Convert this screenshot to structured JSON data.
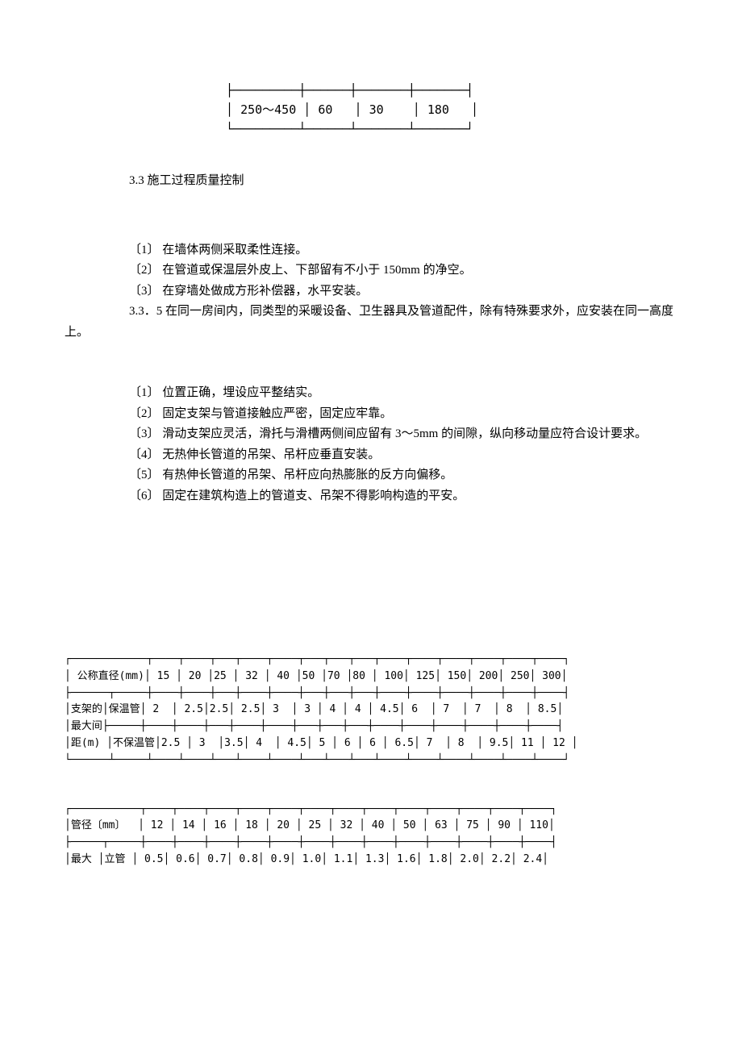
{
  "table1": {
    "row": [
      "250～450",
      "60",
      "30",
      "180"
    ]
  },
  "heading": "3.3 施工过程质量控制",
  "list1": {
    "item1": "〔1〕 在墙体两侧采取柔性连接。",
    "item2": "〔2〕 在管道或保温层外皮上、下部留有不小于 150mm 的净空。",
    "item3": "〔3〕 在穿墙处做成方形补偿器，水平安装。",
    "note": "3.3．5 在同一房间内，同类型的采暖设备、卫生器具及管道配件，除有特殊要求外，应安装在同一高度上。"
  },
  "list2": {
    "item1": "〔1〕 位置正确，埋设应平整结实。",
    "item2": "〔2〕 固定支架与管道接触应严密，固定应牢靠。",
    "item3": "〔3〕 滑动支架应灵活，滑托与滑槽两侧间应留有 3～5mm 的间隙，纵向移动量应符合设计要求。",
    "item4": "〔4〕 无热伸长管道的吊架、吊杆应垂直安装。",
    "item5": "〔5〕 有热伸长管道的吊架、吊杆应向热膨胀的反方向偏移。",
    "item6": "〔6〕 固定在建筑构造上的管道支、吊架不得影响构造的平安。"
  },
  "table2": {
    "header_label": "公称直径(mm)",
    "headers": [
      "15",
      "20",
      "25",
      "32",
      "40",
      "50",
      "70",
      "80",
      "100",
      "125",
      "150",
      "200",
      "250",
      "300"
    ],
    "row_group_label": "支架的最大间距(m)",
    "row1_label": "保温管",
    "row1": [
      "2",
      "2.5",
      "2.5",
      "2.5",
      "3",
      "3",
      "4",
      "4",
      "4.5",
      "6",
      "7",
      "7",
      "8",
      "8.5"
    ],
    "row2_label": "不保温管",
    "row2": [
      "2.5",
      "3",
      "3.5",
      "4",
      "4.5",
      "5",
      "6",
      "6",
      "6.5",
      "7",
      "8",
      "9.5",
      "11",
      "12"
    ]
  },
  "table3": {
    "header_label": "管径〔mm〕",
    "headers": [
      "12",
      "14",
      "16",
      "18",
      "20",
      "25",
      "32",
      "40",
      "50",
      "63",
      "75",
      "90",
      "110"
    ],
    "row_group_label": "最大",
    "row1_label": "立管",
    "row1": [
      "0.5",
      "0.6",
      "0.7",
      "0.8",
      "0.9",
      "1.0",
      "1.1",
      "1.3",
      "1.6",
      "1.8",
      "2.0",
      "2.2",
      "2.4"
    ]
  }
}
